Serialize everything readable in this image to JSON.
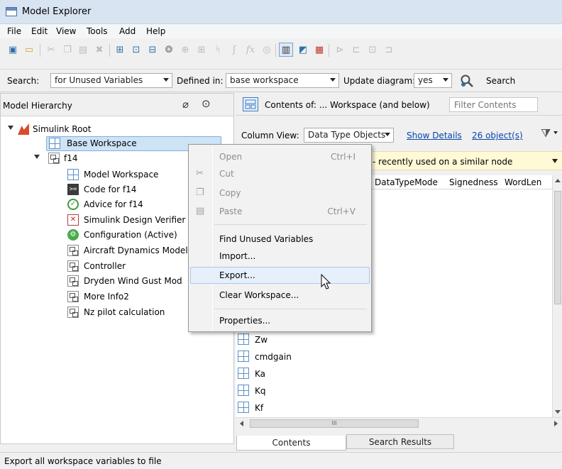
{
  "window": {
    "title": "Model Explorer"
  },
  "menubar": {
    "items": [
      "File",
      "Edit",
      "View",
      "Tools",
      "Add",
      "Help"
    ]
  },
  "toolbar": {
    "icons": [
      "new-model-icon",
      "open-folder-icon",
      "cut-icon",
      "copy-icon",
      "paste-icon",
      "delete-icon",
      "add-variable-icon",
      "add-matlab-variable-icon",
      "add-configuration-icon",
      "add-block-icon",
      "search-icon",
      "add-data-icon",
      "add-signal-icon",
      "add-stateflow-icon",
      "fx-icon",
      "target-icon",
      "column-view-icon",
      "dialog-view-icon",
      "show-grid-icon",
      "model-properties-icon",
      "refresh-icon",
      "layout-icon",
      "help-icon"
    ]
  },
  "searchbar": {
    "search_label": "Search:",
    "search_value": "for Unused Variables",
    "defined_label": "Defined in:",
    "defined_value": "base workspace",
    "update_label": "Update diagram:",
    "update_value": "yes",
    "search_button": "Search"
  },
  "left": {
    "header": "Model Hierarchy",
    "tree": [
      {
        "label": "Simulink Root"
      },
      {
        "label": "Base Workspace"
      },
      {
        "label": "f14"
      },
      {
        "label": "Model Workspace"
      },
      {
        "label": "Code for f14"
      },
      {
        "label": "Advice for f14"
      },
      {
        "label": "Simulink Design Verifier"
      },
      {
        "label": "Configuration (Active)"
      },
      {
        "label": "Aircraft Dynamics Model"
      },
      {
        "label": "Controller"
      },
      {
        "label": "Dryden Wind Gust Mod"
      },
      {
        "label": "More Info2"
      },
      {
        "label": "Nz pilot calculation"
      }
    ]
  },
  "right": {
    "contents_of": "Contents of:  ... Workspace  (and below)",
    "filter_placeholder": "Filter Contents",
    "column_view_label": "Column View:",
    "column_view_value": "Data Type Objects",
    "show_details": "Show Details",
    "object_count": "26 object(s)",
    "info_text": "- recently used on a similar node",
    "columns": [
      "DataTypeMode",
      "Signedness",
      "WordLen"
    ],
    "variables": [
      "Zw",
      "cmdgain",
      "Ka",
      "Kq",
      "Kf"
    ],
    "hscroll_mark": "III",
    "tabs": [
      "Contents",
      "Search Results"
    ]
  },
  "context_menu": {
    "items": [
      {
        "label": "Open",
        "shortcut": "Ctrl+I"
      },
      {
        "label": "Cut",
        "shortcut": ""
      },
      {
        "label": "Copy",
        "shortcut": ""
      },
      {
        "label": "Paste",
        "shortcut": "Ctrl+V"
      },
      {
        "label": "Find Unused Variables",
        "shortcut": ""
      },
      {
        "label": "Import...",
        "shortcut": ""
      },
      {
        "label": "Export...",
        "shortcut": ""
      },
      {
        "label": "Clear Workspace...",
        "shortcut": ""
      },
      {
        "label": "Properties...",
        "shortcut": ""
      }
    ]
  },
  "statusbar": {
    "text": "Export all workspace variables to file"
  },
  "colors": {
    "selection": "#cde4f7",
    "selection_border": "#84acdd",
    "info_bar": "#fff9d6",
    "link": "#0645ad"
  }
}
